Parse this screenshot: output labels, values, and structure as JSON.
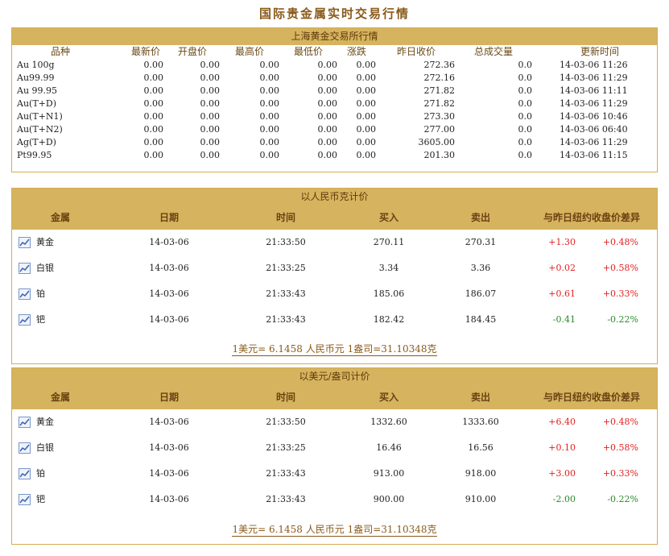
{
  "title": "国际贵金属实时交易行情",
  "sge": {
    "heading": "上海黄金交易所行情",
    "columns": [
      "品种",
      "最新价",
      "开盘价",
      "最高价",
      "最低价",
      "涨跌",
      "昨日收价",
      "总成交量",
      "更新时间"
    ],
    "rows": [
      [
        "Au 100g",
        "0.00",
        "0.00",
        "0.00",
        "0.00",
        "0.00",
        "272.36",
        "0.0",
        "14-03-06 11:26"
      ],
      [
        "Au99.99",
        "0.00",
        "0.00",
        "0.00",
        "0.00",
        "0.00",
        "272.16",
        "0.0",
        "14-03-06 11:29"
      ],
      [
        "Au 99.95",
        "0.00",
        "0.00",
        "0.00",
        "0.00",
        "0.00",
        "271.82",
        "0.0",
        "14-03-06 11:11"
      ],
      [
        "Au(T+D)",
        "0.00",
        "0.00",
        "0.00",
        "0.00",
        "0.00",
        "271.82",
        "0.0",
        "14-03-06 11:29"
      ],
      [
        "Au(T+N1)",
        "0.00",
        "0.00",
        "0.00",
        "0.00",
        "0.00",
        "273.30",
        "0.0",
        "14-03-06 10:46"
      ],
      [
        "Au(T+N2)",
        "0.00",
        "0.00",
        "0.00",
        "0.00",
        "0.00",
        "277.00",
        "0.0",
        "14-03-06 06:40"
      ],
      [
        "Ag(T+D)",
        "0.00",
        "0.00",
        "0.00",
        "0.00",
        "0.00",
        "3605.00",
        "0.0",
        "14-03-06 11:29"
      ],
      [
        "Pt99.95",
        "0.00",
        "0.00",
        "0.00",
        "0.00",
        "0.00",
        "201.30",
        "0.0",
        "14-03-06 11:15"
      ]
    ]
  },
  "rmb": {
    "heading": "以人民币克计价",
    "columns": [
      "金属",
      "日期",
      "时间",
      "买入",
      "卖出",
      "与昨日纽约收盘价差异"
    ],
    "rows": [
      {
        "metal": "黄金",
        "date": "14-03-06",
        "time": "21:33:50",
        "buy": "270.11",
        "sell": "270.31",
        "chg": "+1.30",
        "pct": "+0.48%",
        "dir": "up"
      },
      {
        "metal": "白银",
        "date": "14-03-06",
        "time": "21:33:25",
        "buy": "3.34",
        "sell": "3.36",
        "chg": "+0.02",
        "pct": "+0.58%",
        "dir": "up"
      },
      {
        "metal": "铂",
        "date": "14-03-06",
        "time": "21:33:43",
        "buy": "185.06",
        "sell": "186.07",
        "chg": "+0.61",
        "pct": "+0.33%",
        "dir": "up"
      },
      {
        "metal": "钯",
        "date": "14-03-06",
        "time": "21:33:43",
        "buy": "182.42",
        "sell": "184.45",
        "chg": "-0.41",
        "pct": "-0.22%",
        "dir": "down"
      }
    ],
    "note": "1美元= 6.1458 人民币元    1盎司=31.10348克"
  },
  "usd": {
    "heading": "以美元/盎司计价",
    "columns": [
      "金属",
      "日期",
      "时间",
      "买入",
      "卖出",
      "与昨日纽约收盘价差异"
    ],
    "rows": [
      {
        "metal": "黄金",
        "date": "14-03-06",
        "time": "21:33:50",
        "buy": "1332.60",
        "sell": "1333.60",
        "chg": "+6.40",
        "pct": "+0.48%",
        "dir": "up"
      },
      {
        "metal": "白银",
        "date": "14-03-06",
        "time": "21:33:25",
        "buy": "16.46",
        "sell": "16.56",
        "chg": "+0.10",
        "pct": "+0.58%",
        "dir": "up"
      },
      {
        "metal": "铂",
        "date": "14-03-06",
        "time": "21:33:43",
        "buy": "913.00",
        "sell": "918.00",
        "chg": "+3.00",
        "pct": "+0.33%",
        "dir": "up"
      },
      {
        "metal": "钯",
        "date": "14-03-06",
        "time": "21:33:43",
        "buy": "900.00",
        "sell": "910.00",
        "chg": "-2.00",
        "pct": "-0.22%",
        "dir": "down"
      }
    ],
    "note": "1美元= 6.1458 人民币元    1盎司=31.10348克"
  },
  "colors": {
    "header_bg": "#d6b35e",
    "border": "#d4ad55",
    "title": "#8a5a1a",
    "up": "#e02020",
    "down": "#2a8a2a"
  },
  "icons": {
    "row_icon": "line-chart-icon"
  }
}
